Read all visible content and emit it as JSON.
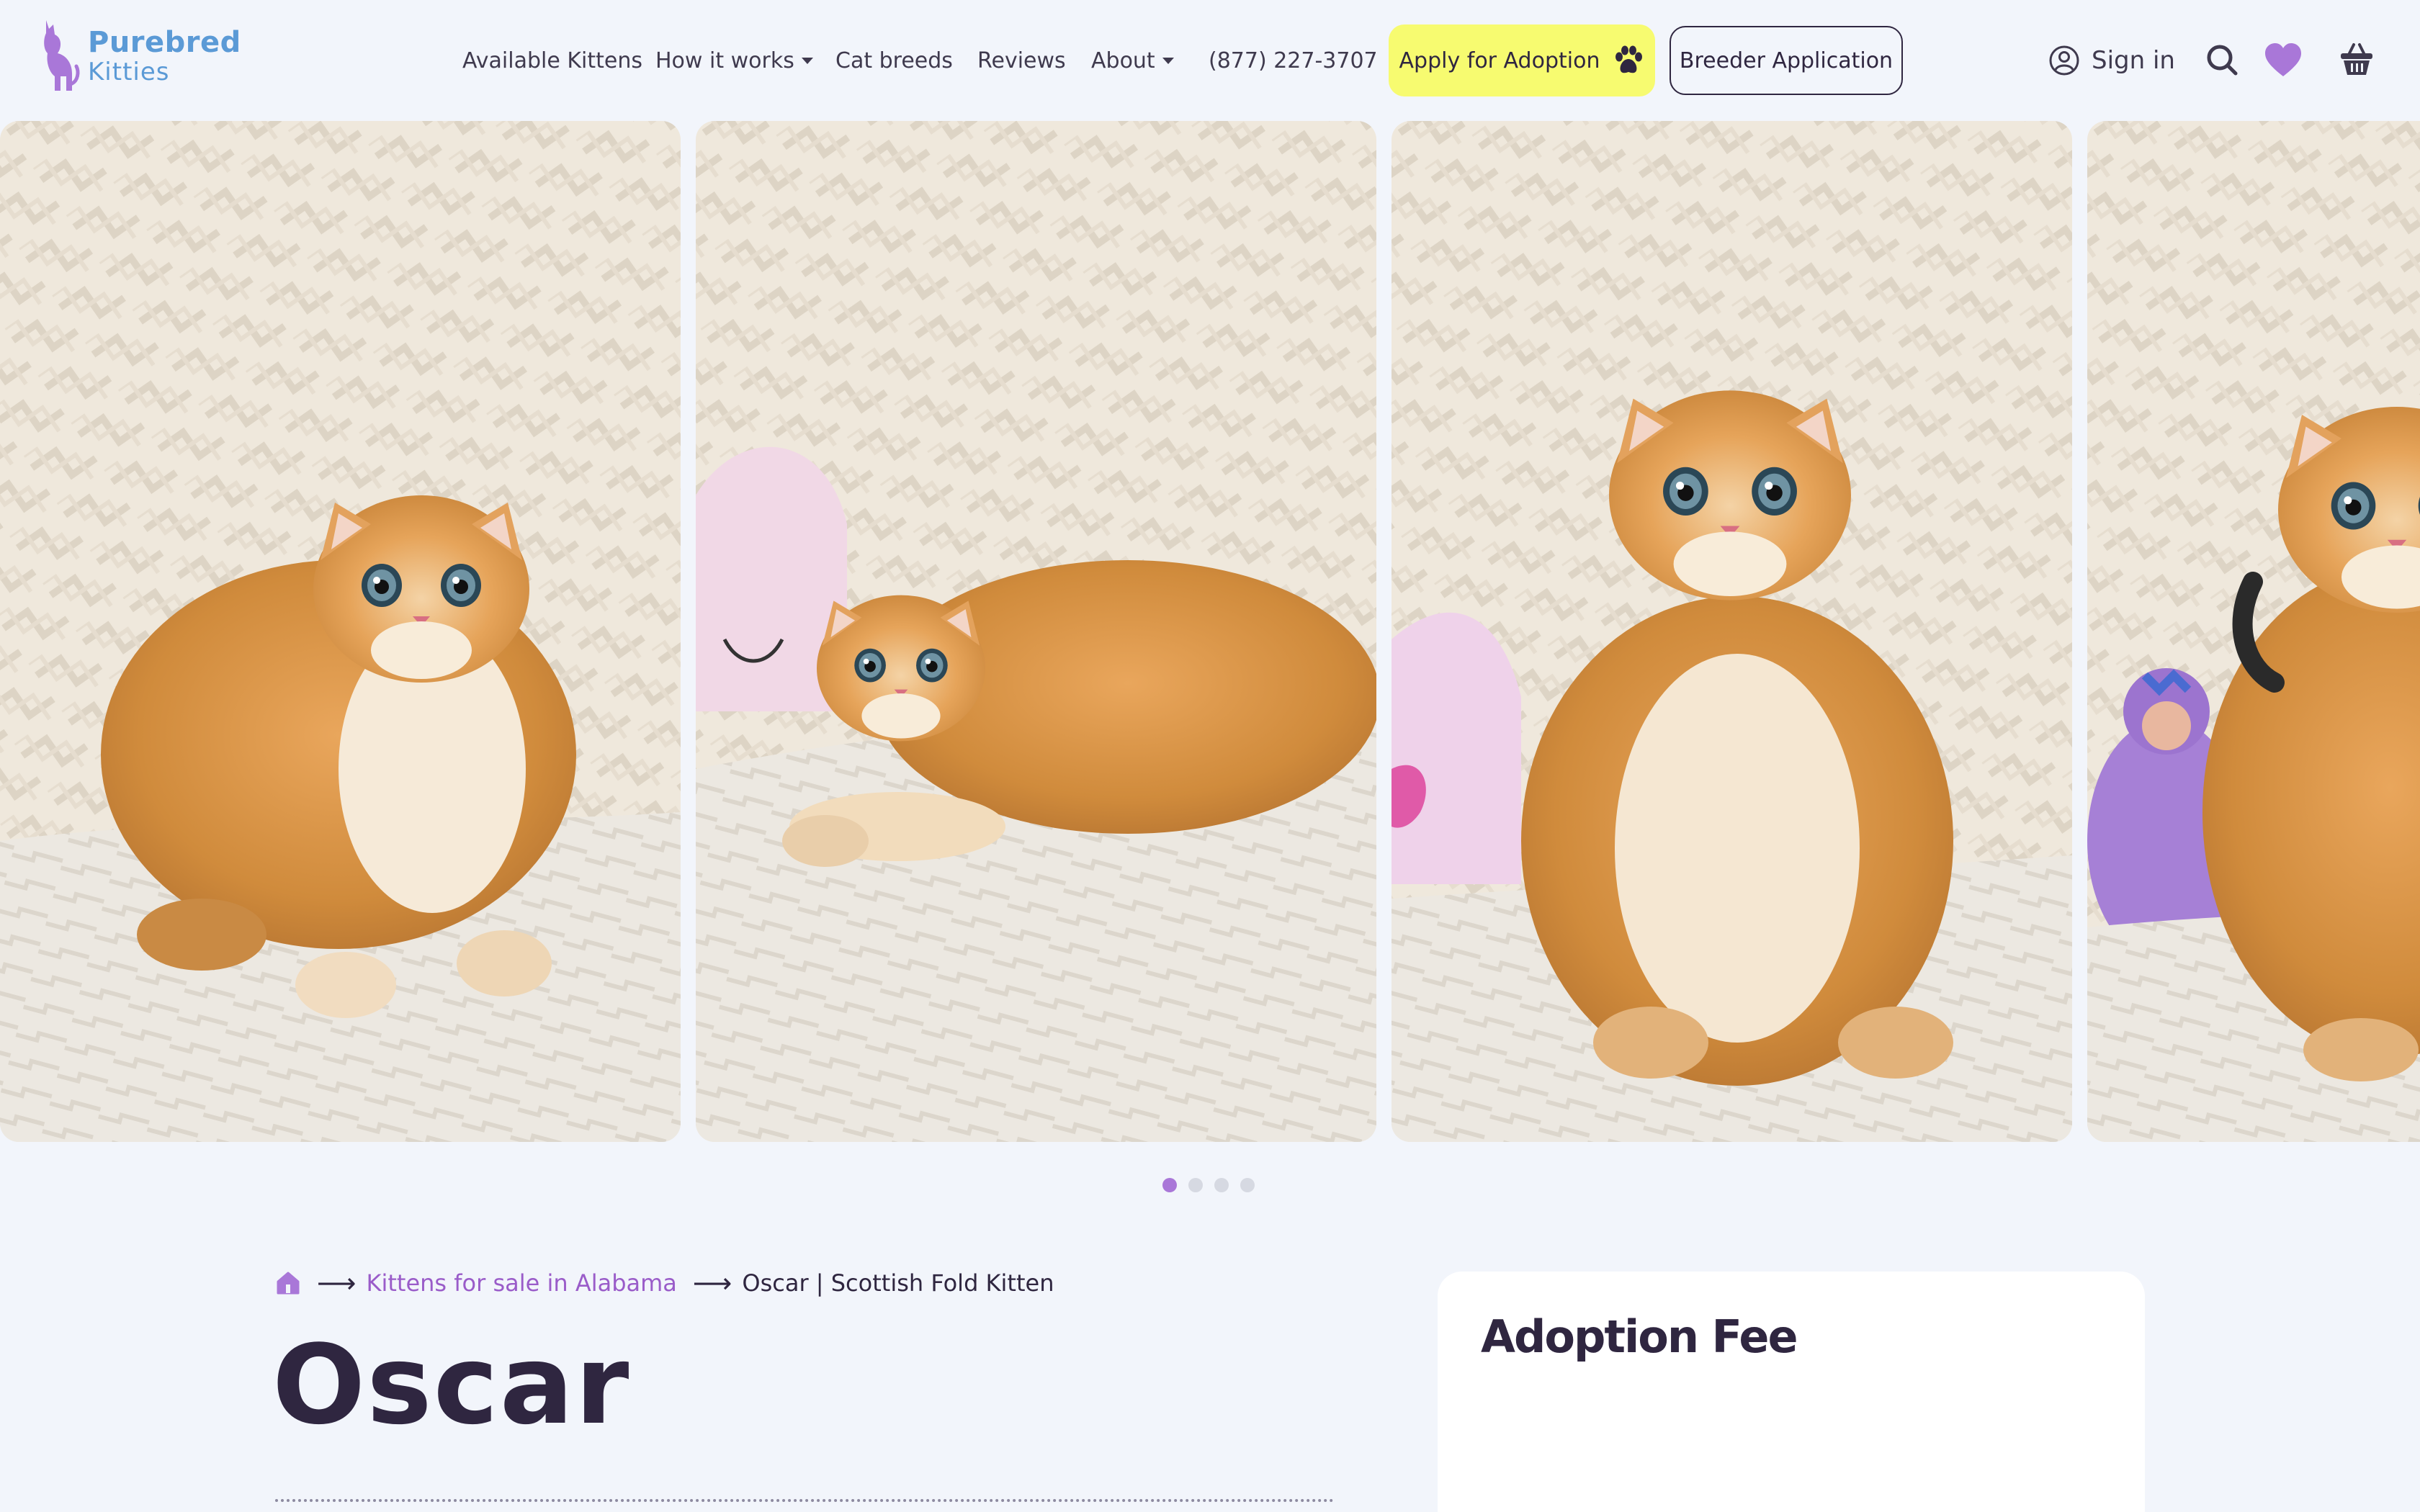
{
  "logo": {
    "line1": "Purebred",
    "line2": "Kitties",
    "color": "#5b9ad6",
    "accent": "#a977d8"
  },
  "nav": {
    "available": "Available Kittens",
    "how": "How it works",
    "breeds": "Cat breeds",
    "reviews": "Reviews",
    "about": "About",
    "phone": "(877) 227-3707"
  },
  "apply": {
    "label": "Apply for Adoption",
    "icon": "paw-icon",
    "color": "#f7fb70"
  },
  "breeder": {
    "label": "Breeder Application"
  },
  "account": {
    "signin": "Sign in",
    "icons": [
      "user-circle-icon",
      "search-icon",
      "heart-icon",
      "basket-icon"
    ]
  },
  "gallery": {
    "photos": [
      "Scottish fold kitten sitting on textured white rug",
      "Scottish fold kitten lying down on textured white rug",
      "Scottish fold kitten sitting facing camera",
      "Scottish fold kitten next to purple toy"
    ],
    "slide_count": 4,
    "active_slide": 1
  },
  "breadcrumb": {
    "home_icon": "home-icon",
    "category": "Kittens for sale in Alabama",
    "current": "Oscar | Scottish Fold Kitten"
  },
  "kitten": {
    "name": "Oscar"
  },
  "fee": {
    "title": "Adoption Fee"
  },
  "colors": {
    "background": "#f2f5fb",
    "text": "#2f2640",
    "link": "#9a5cc9",
    "dot_active": "#a977d8"
  }
}
